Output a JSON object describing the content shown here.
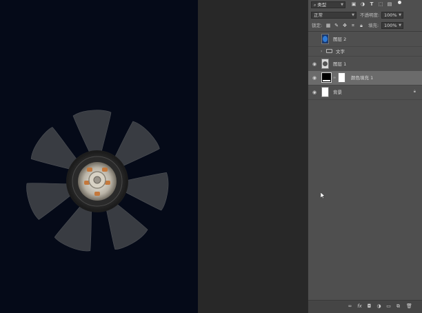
{
  "layers_panel": {
    "filter": {
      "selected": "类型",
      "icons": [
        "image-filter-icon",
        "adjustment-filter-icon",
        "type-filter-icon",
        "shape-filter-icon",
        "smart-object-filter-icon"
      ]
    },
    "blend_mode": "正常",
    "opacity_label": "不透明度:",
    "opacity_value": "100%",
    "lock_label": "锁定:",
    "fill_label": "填充:",
    "fill_value": "100%",
    "layers": [
      {
        "name": "图层 2",
        "visible": false,
        "type": "image"
      },
      {
        "name": "文字",
        "visible": false,
        "type": "group"
      },
      {
        "name": "图层 1",
        "visible": true,
        "type": "image"
      },
      {
        "name": "颜色填充 1",
        "visible": true,
        "type": "fill",
        "selected": true
      },
      {
        "name": "背景",
        "visible": true,
        "type": "background",
        "locked": true
      }
    ]
  },
  "canvas": {
    "background_color": "#050a18",
    "subject": "cooling fan"
  }
}
